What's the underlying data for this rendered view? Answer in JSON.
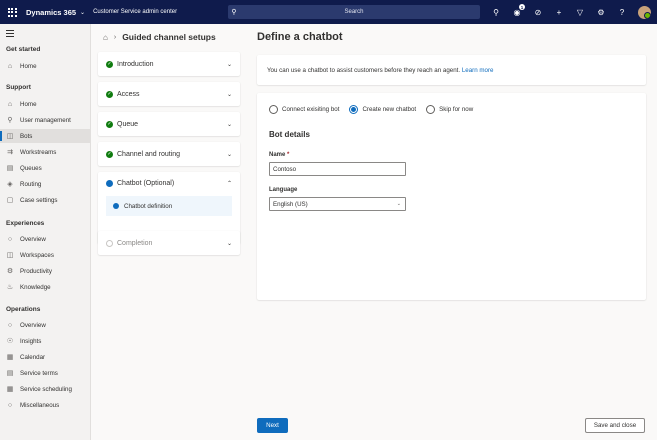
{
  "topbar": {
    "app_name": "Dynamics 365",
    "area_name": "Customer Service admin center",
    "search_placeholder": "Search",
    "notification_count": "1"
  },
  "nav": {
    "sections": {
      "get_started": "Get started",
      "support": "Support",
      "experiences": "Experiences",
      "operations": "Operations"
    },
    "items": {
      "home_top": "Home",
      "home": "Home",
      "user_management": "User management",
      "bots": "Bots",
      "workstreams": "Workstreams",
      "queues": "Queues",
      "routing": "Routing",
      "case_settings": "Case settings",
      "overview_exp": "Overview",
      "workspaces": "Workspaces",
      "productivity": "Productivity",
      "knowledge": "Knowledge",
      "overview_ops": "Overview",
      "insights": "Insights",
      "calendar": "Calendar",
      "service_terms": "Service terms",
      "service_scheduling": "Service scheduling",
      "miscellaneous": "Miscellaneous"
    }
  },
  "steps": {
    "breadcrumb_title": "Guided channel setups",
    "introduction": "Introduction",
    "access": "Access",
    "queue": "Queue",
    "channel_routing": "Channel and routing",
    "chatbot": "Chatbot (Optional)",
    "chatbot_definition": "Chatbot definition",
    "completion": "Completion"
  },
  "main": {
    "title": "Define a chatbot",
    "info_text": "You can use a chatbot to assist customers before they reach an agent.",
    "info_link": "Learn more",
    "radio_connect": "Connect exisiting bot",
    "radio_create": "Create new chatbot",
    "radio_skip": "Skip for now",
    "selected_option": "Create new chatbot",
    "bot_details": "Bot details",
    "name_label": "Name",
    "required_mark": "*",
    "name_value": "Contoso",
    "language_label": "Language",
    "language_value": "English (US)"
  },
  "footer": {
    "next": "Next",
    "save_close": "Save and close"
  },
  "colors": {
    "topbar": "#0f1b4c",
    "accent": "#0f6cbd",
    "success": "#107c10"
  }
}
